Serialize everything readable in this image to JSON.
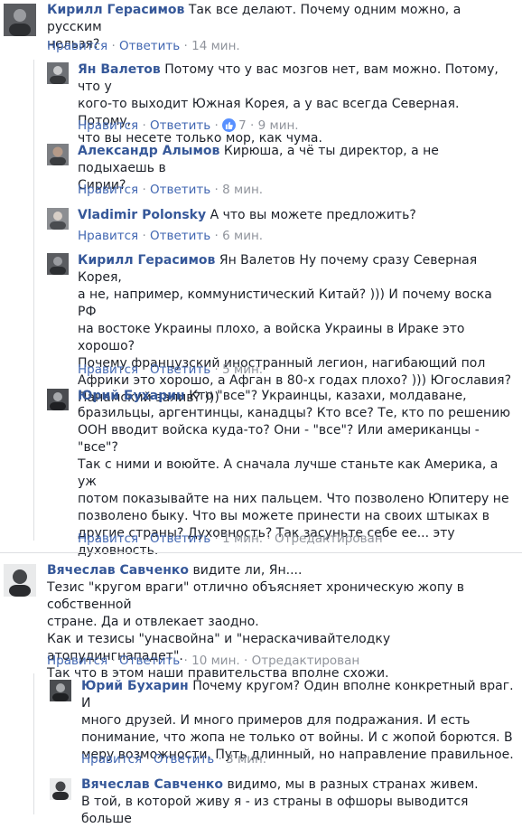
{
  "comments": [
    {
      "id": "c1",
      "author": "Кирилл Герасимов",
      "lines": [
        "Так все делают. Почему одним можно, а русским",
        "нельзя?"
      ],
      "like": "Нравится",
      "reply": "Ответить",
      "time": "14 мин."
    },
    {
      "id": "c2",
      "author": "Ян Валетов",
      "lines": [
        "Потому что у вас мозгов нет, вам можно. Потому, что у",
        "кого-то выходит Южная Корея, а у вас всегда Северная. Потому,",
        "что вы несете только мор, как чума."
      ],
      "like": "Нравится",
      "reply": "Ответить",
      "reactions": "7",
      "time": "9 мин."
    },
    {
      "id": "c3",
      "author": "Александр Алымов",
      "lines": [
        "Кирюша, а чё ты директор, а не подыхаешь в",
        "Сирии?"
      ],
      "like": "Нравится",
      "reply": "Ответить",
      "time": "8 мин."
    },
    {
      "id": "c4",
      "author": "Vladimir Polonsky",
      "lines": [
        "А что вы можете предложить?"
      ],
      "like": "Нравится",
      "reply": "Ответить",
      "time": "6 мин."
    },
    {
      "id": "c5",
      "author": "Кирилл Герасимов",
      "lines": [
        "Ян Валетов Ну почему сразу Северная Корея,",
        "а не, например, коммунистический Китай? ))) И почему воска РФ",
        "на востоке Украины плохо, а войска Украины в Ираке это хорошо?",
        "Почему французский иностранный легион, нагибающий пол",
        "Африки это хорошо, а Афган в 80-х годах плохо? ))) Югославия?",
        "Панамский залив? )))"
      ],
      "like": "Нравится",
      "reply": "Ответить",
      "time": "5 мин."
    },
    {
      "id": "c6",
      "author": "Юрий Бухарин",
      "lines": [
        "Кто \"все\"? Украинцы, казахи, молдаване,",
        "бразильцы, аргентинцы, канадцы? Кто все? Те, кто по решению",
        "ООН вводит войска куда-то? Они - \"все\"? Или американцы - \"все\"?",
        "Так с ними и воюйте. А сначала лучше станьте как Америка, а уж",
        "потом показывайте на них пальцем. Что позволено Юпитеру не",
        "позволено быку. Что вы можете принести на своих штыках в",
        "другие страны? Духовность? Так засуньте себе ее... эту",
        "духовность."
      ],
      "like": "Нравится",
      "reply": "Ответить",
      "time": "1 мин.",
      "edited": "Отредактирован"
    },
    {
      "id": "c7",
      "author": "Вячеслав Савченко",
      "lines": [
        "видите ли, Ян....",
        "Тезис \"кругом враги\" отлично объясняет хроническую жопу в собственной",
        "стране. Да и отвлекает заодно.",
        "Как и тезисы \"унасвойна\" и \"нераскачивайтелодку атопудингнападет\".",
        "Так что в этом наши правительства вполне схожи."
      ],
      "like": "Нравится",
      "reply": "Ответить",
      "time": "10 мин.",
      "edited": "Отредактирован"
    },
    {
      "id": "c8",
      "author": "Юрий Бухарин",
      "lines": [
        "Почему кругом? Один вполне конкретный враг. И",
        "много друзей. И много примеров для подражания. И есть",
        "понимание, что жопа не только от войны. И с жопой борются. В",
        "меру возможности. Путь длинный, но направление правильное."
      ],
      "like": "Нравится",
      "reply": "Ответить",
      "time": "3 мин."
    },
    {
      "id": "c9",
      "author": "Вячеслав Савченко",
      "lines": [
        "видимо, мы в разных странах живем.",
        "В той, в которой живу я - из страны в офшоры выводится больше"
      ]
    }
  ],
  "colors": {
    "author": "#365899",
    "link": "#4267b2",
    "meta": "#90949c",
    "text": "#1d2129",
    "like_badge": "#5890ff"
  }
}
